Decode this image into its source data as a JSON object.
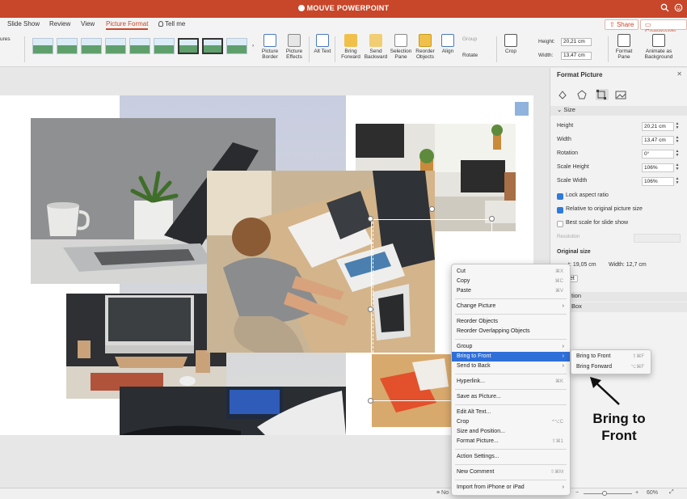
{
  "window": {
    "title": "MOUVE POWERPOINT"
  },
  "tabs": {
    "items": [
      {
        "label": "Slide Show"
      },
      {
        "label": "Review"
      },
      {
        "label": "View"
      },
      {
        "label": "Picture Format"
      },
      {
        "label": "Tell me"
      }
    ],
    "share": "Share",
    "comments": "Comments"
  },
  "ribbon": {
    "left_label": "ures",
    "picture_border": "Picture Border",
    "picture_effects": "Picture Effects",
    "alt_text": "Alt Text",
    "bring_forward": "Bring Forward",
    "send_backward": "Send Backward",
    "selection_pane": "Selection Pane",
    "reorder_objects": "Reorder Objects",
    "align": "Align",
    "group": "Group",
    "rotate": "Rotate",
    "crop": "Crop",
    "height_label": "Height:",
    "height_value": "20,21 cm",
    "width_label": "Width:",
    "width_value": "13,47 cm",
    "format_pane": "Format Pane",
    "animate_as_background": "Animate as Background"
  },
  "pane": {
    "title": "Format Picture",
    "size_section": "Size",
    "height_label": "Height",
    "height_value": "20,21 cm",
    "width_label": "Width",
    "width_value": "13,47 cm",
    "rotation_label": "Rotation",
    "rotation_value": "0°",
    "scale_height_label": "Scale Height",
    "scale_height_value": "106%",
    "scale_width_label": "Scale Width",
    "scale_width_value": "106%",
    "lock_aspect": "Lock aspect ratio",
    "relative_original": "Relative to original picture size",
    "best_scale": "Best scale for slide show",
    "resolution_label": "Resolution",
    "original_size": "Original size",
    "original_height": "t:  19,05 cm",
    "original_width": "Width:   12,7 cm",
    "reset": "et",
    "position_partial": "tion",
    "textbox_partial": "Box"
  },
  "context_menu": {
    "items": [
      {
        "label": "Cut",
        "shortcut": "⌘X"
      },
      {
        "label": "Copy",
        "shortcut": "⌘C"
      },
      {
        "label": "Paste",
        "shortcut": "⌘V"
      },
      {
        "label": "Change Picture",
        "arrow": "›"
      },
      {
        "label": "Reorder Objects"
      },
      {
        "label": "Reorder Overlapping Objects"
      },
      {
        "label": "Group",
        "arrow": "›"
      },
      {
        "label": "Bring to Front",
        "arrow": "›"
      },
      {
        "label": "Send to Back",
        "arrow": "›"
      },
      {
        "label": "Hyperlink...",
        "shortcut": "⌘K"
      },
      {
        "label": "Save as Picture..."
      },
      {
        "label": "Edit Alt Text..."
      },
      {
        "label": "Crop",
        "shortcut": "^⌥C"
      },
      {
        "label": "Size and Position..."
      },
      {
        "label": "Format Picture...",
        "shortcut": "⇧⌘1"
      },
      {
        "label": "Action Settings..."
      },
      {
        "label": "New Comment",
        "shortcut": "⇧⌘M"
      },
      {
        "label": "Import from iPhone or iPad",
        "arrow": "›"
      }
    ]
  },
  "submenu": {
    "items": [
      {
        "label": "Bring to Front",
        "shortcut": "⇧⌘F"
      },
      {
        "label": "Bring Forward",
        "shortcut": "⌥⌘F"
      }
    ]
  },
  "annotation": {
    "line1": "Bring to",
    "line2": "Front"
  },
  "status": {
    "notes": "No",
    "zoom": "60%"
  },
  "colors": {
    "accent": "#c8462a",
    "highlight": "#2f6fd8"
  }
}
